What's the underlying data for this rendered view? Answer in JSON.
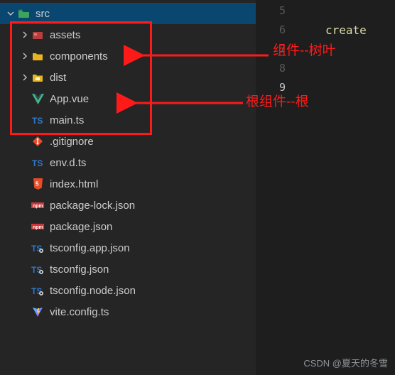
{
  "tree": {
    "root": {
      "label": "src"
    },
    "items": [
      {
        "label": "assets"
      },
      {
        "label": "components"
      },
      {
        "label": "dist"
      },
      {
        "label": "App.vue"
      },
      {
        "label": "main.ts"
      }
    ],
    "siblings": [
      {
        "label": ".gitignore"
      },
      {
        "label": "env.d.ts"
      },
      {
        "label": "index.html"
      },
      {
        "label": "package-lock.json"
      },
      {
        "label": "package.json"
      },
      {
        "label": "tsconfig.app.json"
      },
      {
        "label": "tsconfig.json"
      },
      {
        "label": "tsconfig.node.json"
      },
      {
        "label": "vite.config.ts"
      }
    ]
  },
  "editor": {
    "lines": [
      "5",
      "6",
      "7",
      "8",
      "9"
    ],
    "current_line": "9",
    "content": {
      "6": "create"
    }
  },
  "annotations": {
    "a1": "组件--树叶",
    "a2": "根组件--根"
  },
  "watermark": "CSDN @夏天的冬雪",
  "colors": {
    "red": "#ff1a1a",
    "selected": "#094771"
  }
}
